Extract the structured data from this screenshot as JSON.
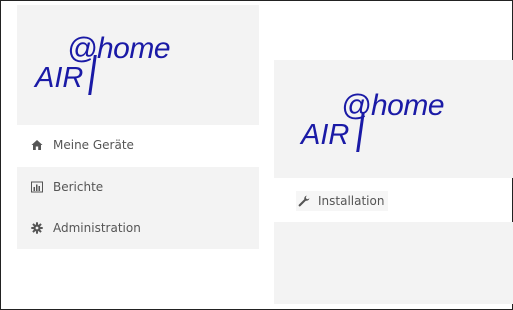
{
  "logo": {
    "at_home": "@home",
    "air": "AIR"
  },
  "sidebar": {
    "items": [
      {
        "label": "Meine Geräte",
        "icon": "home-icon"
      },
      {
        "label": "Berichte",
        "icon": "bar-chart-icon"
      },
      {
        "label": "Administration",
        "icon": "gear-icon"
      }
    ]
  },
  "panel": {
    "items": [
      {
        "label": "Installation",
        "icon": "wrench-icon"
      }
    ]
  },
  "colors": {
    "brand_blue": "#1a1aa6",
    "panel_bg": "#f3f3f3",
    "text": "#555555"
  }
}
